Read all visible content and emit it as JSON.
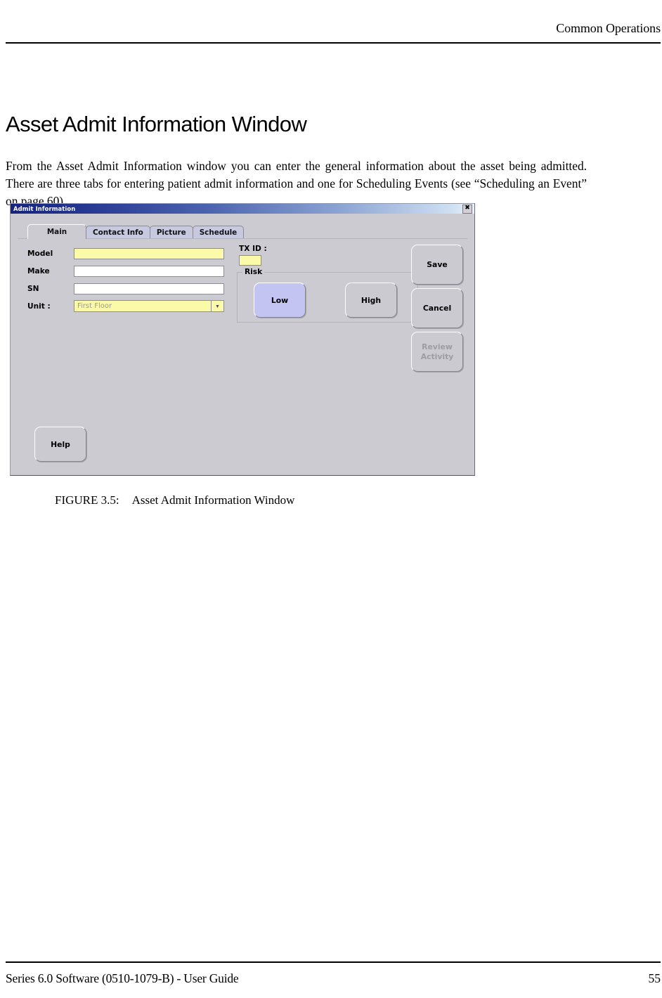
{
  "page": {
    "running_header": "Common Operations",
    "heading": "Asset Admit Information Window",
    "body_paragraph": "From the Asset Admit Information window you can enter the general information about the asset being admitted. There are three tabs for entering patient admit information and one for Scheduling Events (see “Scheduling an Event” on page 60).",
    "figure": {
      "number": "FIGURE 3.5:",
      "caption": "Asset Admit Information Window"
    },
    "footer": {
      "left": "Series 6.0 Software (0510-1079-B) - User Guide",
      "page_number": "55"
    }
  },
  "dialog": {
    "title": "Admit Information",
    "close_icon": "close-icon",
    "titlebar_color_left": "#16247c",
    "titlebar_color_right": "#e8f1fb",
    "body_color": "#cdcbd2",
    "tabs": [
      {
        "label": "Main",
        "active": true
      },
      {
        "label": "Contact Info",
        "active": false
      },
      {
        "label": "Picture",
        "active": false
      },
      {
        "label": "Schedule",
        "active": false
      }
    ],
    "fields": [
      {
        "label": "Model",
        "value": "",
        "type": "text",
        "required": true
      },
      {
        "label": "Make",
        "value": "",
        "type": "text",
        "required": false
      },
      {
        "label": "SN",
        "value": "",
        "type": "text",
        "required": false
      }
    ],
    "unit": {
      "label": "Unit :",
      "value": "First Floor",
      "arrow_icon": "chevron-down-icon",
      "field_color": "#fbfaa8"
    },
    "tx_id": {
      "label": "TX ID :",
      "value": "",
      "field_color": "#fbfaa8"
    },
    "risk": {
      "group_label": "Risk",
      "options": [
        {
          "label": "Low",
          "selected": true,
          "color": "#c3c4f1"
        },
        {
          "label": "High",
          "selected": false,
          "color": "#cbcad1"
        }
      ]
    },
    "actions": [
      {
        "label": "Save",
        "enabled": true
      },
      {
        "label": "Cancel",
        "enabled": true
      },
      {
        "label": "Review Activity",
        "line1": "Review",
        "line2": "Activity",
        "enabled": false
      }
    ],
    "help": {
      "label": "Help"
    }
  }
}
